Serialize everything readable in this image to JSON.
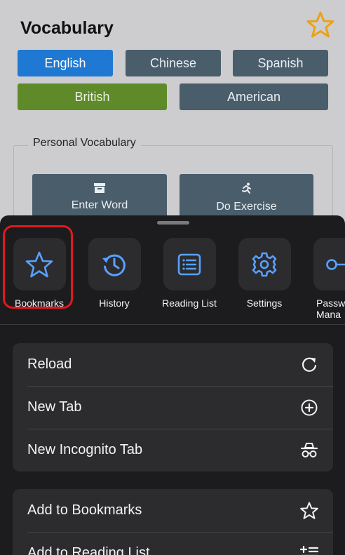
{
  "page": {
    "title": "Vocabulary",
    "lang_buttons": [
      "English",
      "Chinese",
      "Spanish"
    ],
    "dialect_buttons": [
      "British",
      "American"
    ],
    "personal_vocab_label": "Personal Vocabulary",
    "enter_word": "Enter Word",
    "do_exercise": "Do Exercise"
  },
  "menu": {
    "shortcuts": [
      {
        "label": "Bookmarks",
        "icon": "star-icon"
      },
      {
        "label": "History",
        "icon": "history-icon"
      },
      {
        "label": "Reading List",
        "icon": "reading-list-icon"
      },
      {
        "label": "Settings",
        "icon": "gear-icon"
      },
      {
        "label": "Passw\nMana",
        "icon": "key-icon"
      }
    ],
    "group1": [
      "Reload",
      "New Tab",
      "New Incognito Tab"
    ],
    "group2": [
      "Add to Bookmarks",
      "Add to Reading List"
    ]
  },
  "colors": {
    "accent_blue": "#1f78d1",
    "accent_green": "#5f8a2a",
    "icon_blue": "#5aa0ff",
    "highlight_red": "#e0191f"
  }
}
